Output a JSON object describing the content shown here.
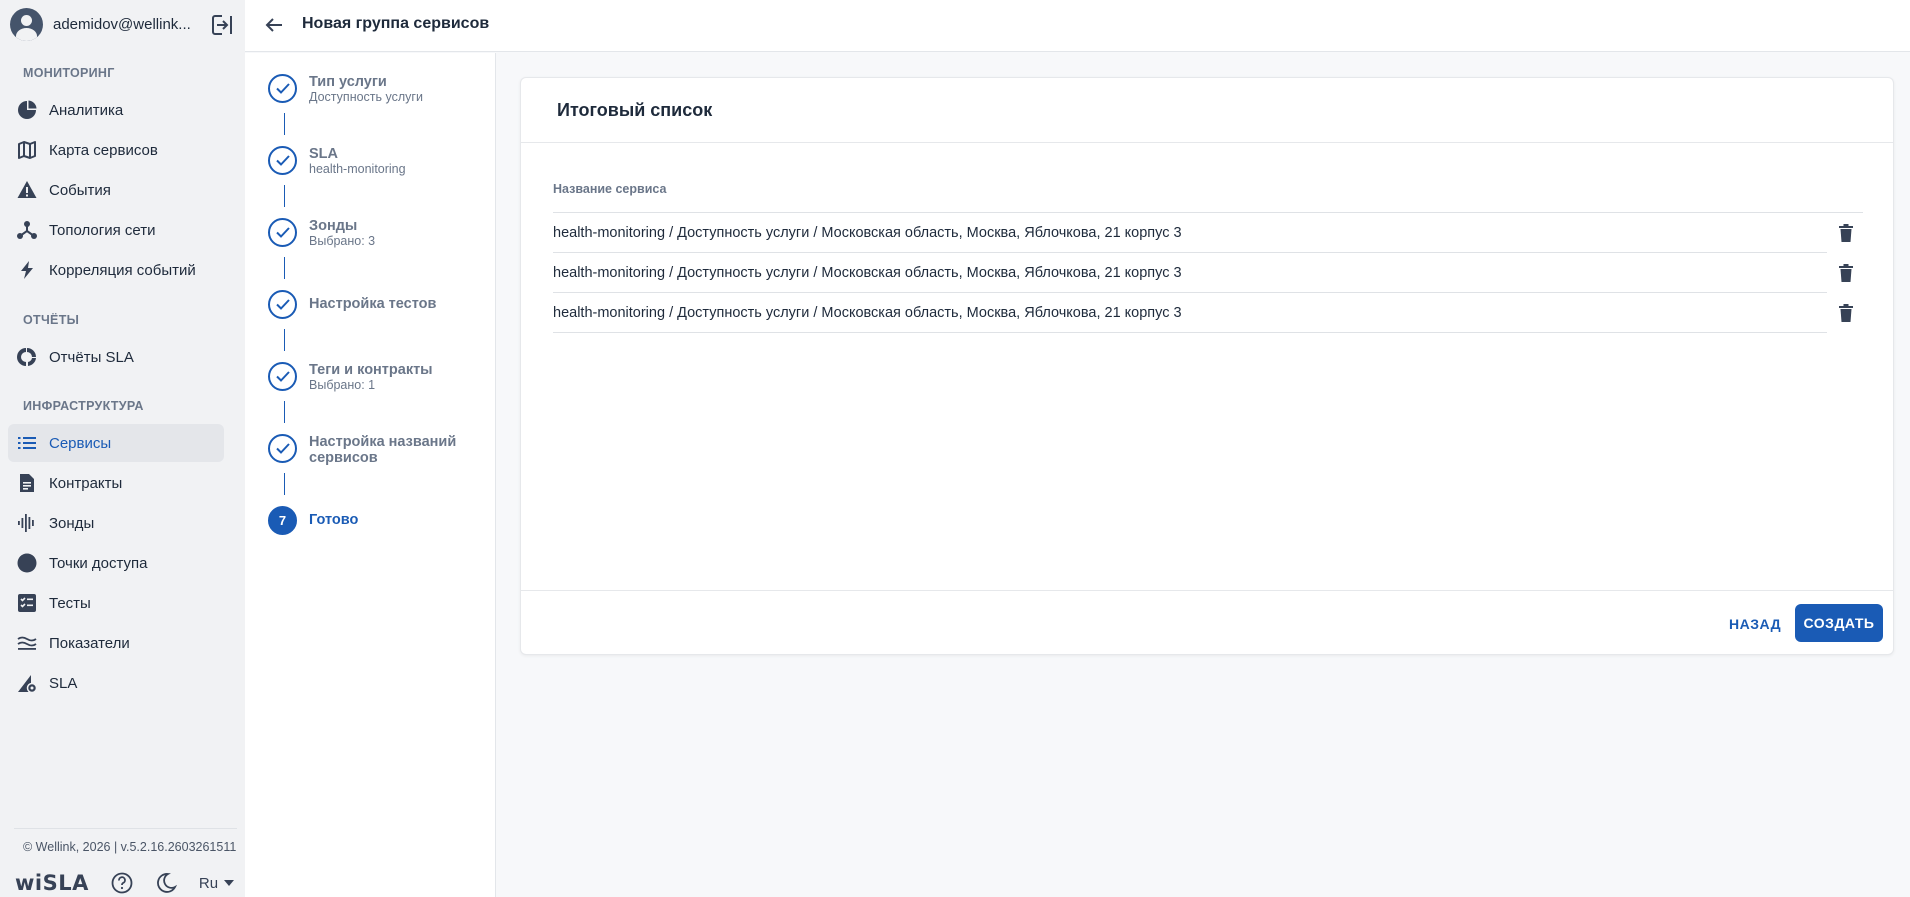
{
  "user": {
    "name": "ademidov@wellink..."
  },
  "sidebar": {
    "sections": [
      {
        "title": "МОНИТОРИНГ",
        "items": [
          {
            "label": "Аналитика",
            "icon": "pie-chart-icon"
          },
          {
            "label": "Карта сервисов",
            "icon": "map-icon"
          },
          {
            "label": "События",
            "icon": "warning-icon"
          },
          {
            "label": "Топология сети",
            "icon": "topology-icon"
          },
          {
            "label": "Корреляция событий",
            "icon": "lightning-icon"
          }
        ]
      },
      {
        "title": "ОТЧЁТЫ",
        "items": [
          {
            "label": "Отчёты SLA",
            "icon": "donut-icon"
          }
        ]
      },
      {
        "title": "ИНФРАСТРУКТУРА",
        "items": [
          {
            "label": "Сервисы",
            "icon": "list-icon",
            "active": true
          },
          {
            "label": "Контракты",
            "icon": "document-icon"
          },
          {
            "label": "Зонды",
            "icon": "probe-icon"
          },
          {
            "label": "Точки доступа",
            "icon": "circle-icon"
          },
          {
            "label": "Тесты",
            "icon": "checklist-icon"
          },
          {
            "label": "Показатели",
            "icon": "indicators-icon"
          },
          {
            "label": "SLA",
            "icon": "sla-icon"
          }
        ]
      }
    ],
    "copyright": "© Wellink, 2026 | v.5.2.16.2603261511",
    "logo": "wiSLA",
    "language": "Ru"
  },
  "header": {
    "title": "Новая группа сервисов"
  },
  "stepper": {
    "steps": [
      {
        "title": "Тип услуги",
        "subtitle": "Доступность услуги",
        "status": "done"
      },
      {
        "title": "SLA",
        "subtitle": "health-monitoring",
        "status": "done"
      },
      {
        "title": "Зонды",
        "subtitle": "Выбрано: 3",
        "status": "done"
      },
      {
        "title": "Настройка тестов",
        "subtitle": "",
        "status": "done"
      },
      {
        "title": "Теги и контракты",
        "subtitle": "Выбрано: 1",
        "status": "done"
      },
      {
        "title": "Настройка названий сервисов",
        "subtitle": "",
        "status": "done"
      },
      {
        "title": "Готово",
        "subtitle": "",
        "status": "current",
        "number": "7"
      }
    ]
  },
  "summary": {
    "title": "Итоговый список",
    "column_header": "Название сервиса",
    "rows": [
      "health-monitoring / Доступность услуги / Московская область, Москва, Яблочкова, 21 корпус 3",
      "health-monitoring / Доступность услуги / Московская область, Москва, Яблочкова, 21 корпус 3",
      "health-monitoring / Доступность услуги / Московская область, Москва, Яблочкова, 21 корпус 3"
    ],
    "back_label": "НАЗАД",
    "create_label": "СОЗДАТЬ"
  },
  "colors": {
    "accent": "#1a5bb5",
    "sidebar_bg": "#f1f2f4",
    "text": "#1e2a3b",
    "muted": "#6a7689"
  }
}
